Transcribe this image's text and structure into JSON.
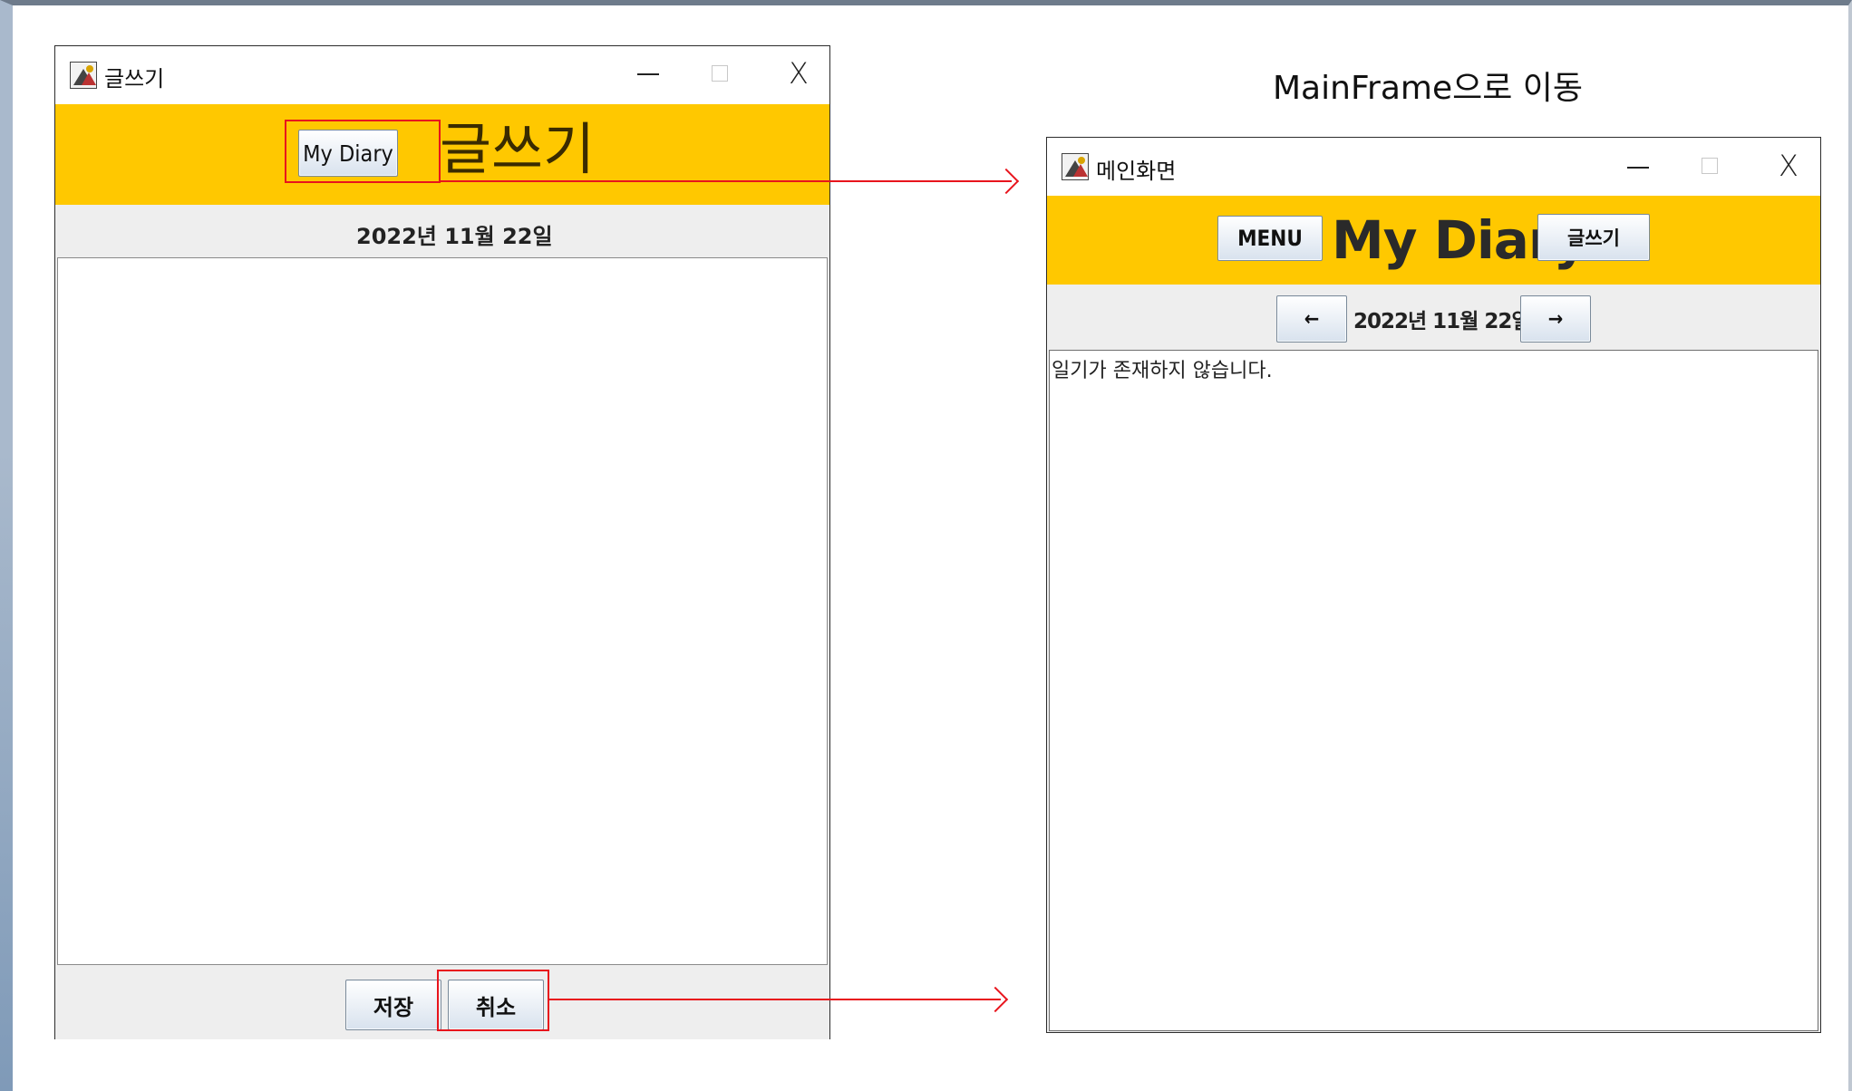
{
  "annotation": {
    "caption": "MainFrame으로 이동"
  },
  "write_window": {
    "title": "글쓰기",
    "controls": {
      "minimize": "–",
      "maximize": "□",
      "close": "X"
    },
    "header": {
      "button_label": "My Diary",
      "heading": "글쓰기"
    },
    "date": "2022년  11월  22일",
    "text_area": "",
    "footer": {
      "save_label": "저장",
      "cancel_label": "취소"
    }
  },
  "main_window": {
    "title": "메인화면",
    "controls": {
      "minimize": "–",
      "maximize": "□",
      "close": "X"
    },
    "header": {
      "menu_label": "MENU",
      "heading": "My Diary",
      "write_label": "글쓰기"
    },
    "nav": {
      "prev_label": "←",
      "date": "2022년 11월 22일",
      "next_label": "→"
    },
    "content": "일기가 존재하지 않습니다."
  },
  "colors": {
    "accent": "#ffc800",
    "annotation": "#e8141c"
  }
}
